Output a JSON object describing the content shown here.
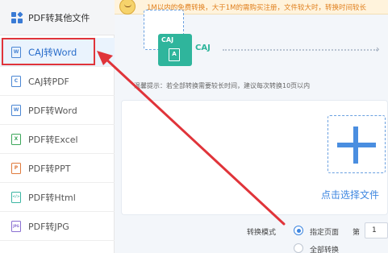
{
  "notice": {
    "text": "1M以内的免费转换，大于1M的需购买注册，文件较大时，转换时间较长"
  },
  "sidebar": {
    "header": "PDF转其他文件",
    "items": [
      {
        "label": "CAJ转Word",
        "icon": "caj-word-icon",
        "glyph": "W"
      },
      {
        "label": "CAJ转PDF",
        "icon": "caj-pdf-icon",
        "glyph": "C"
      },
      {
        "label": "PDF转Word",
        "icon": "word-icon",
        "glyph": "W"
      },
      {
        "label": "PDF转Excel",
        "icon": "excel-icon",
        "glyph": "X"
      },
      {
        "label": "PDF转PPT",
        "icon": "ppt-icon",
        "glyph": "P"
      },
      {
        "label": "PDF转Html",
        "icon": "html-icon",
        "glyph": "</>"
      },
      {
        "label": "PDF转JPG",
        "icon": "jpg-icon",
        "glyph": "JPG"
      }
    ]
  },
  "main": {
    "caj_box_label": "CAJ",
    "caj_doc_glyph": "A",
    "caj_label": "CAJ",
    "tip": "温馨提示：若全部转换需要较长时间，建议每次转换10页以内",
    "choose_link": "点击选择文件",
    "mode_label": "转换模式",
    "mode_options": [
      "指定页面",
      "全部转换"
    ],
    "page_prefix": "第",
    "page_value": "1"
  },
  "colors": {
    "accent": "#3d86e0",
    "caj_green": "#2fb59c",
    "highlight_red": "#e0343a",
    "notice_orange": "#e0801f"
  }
}
